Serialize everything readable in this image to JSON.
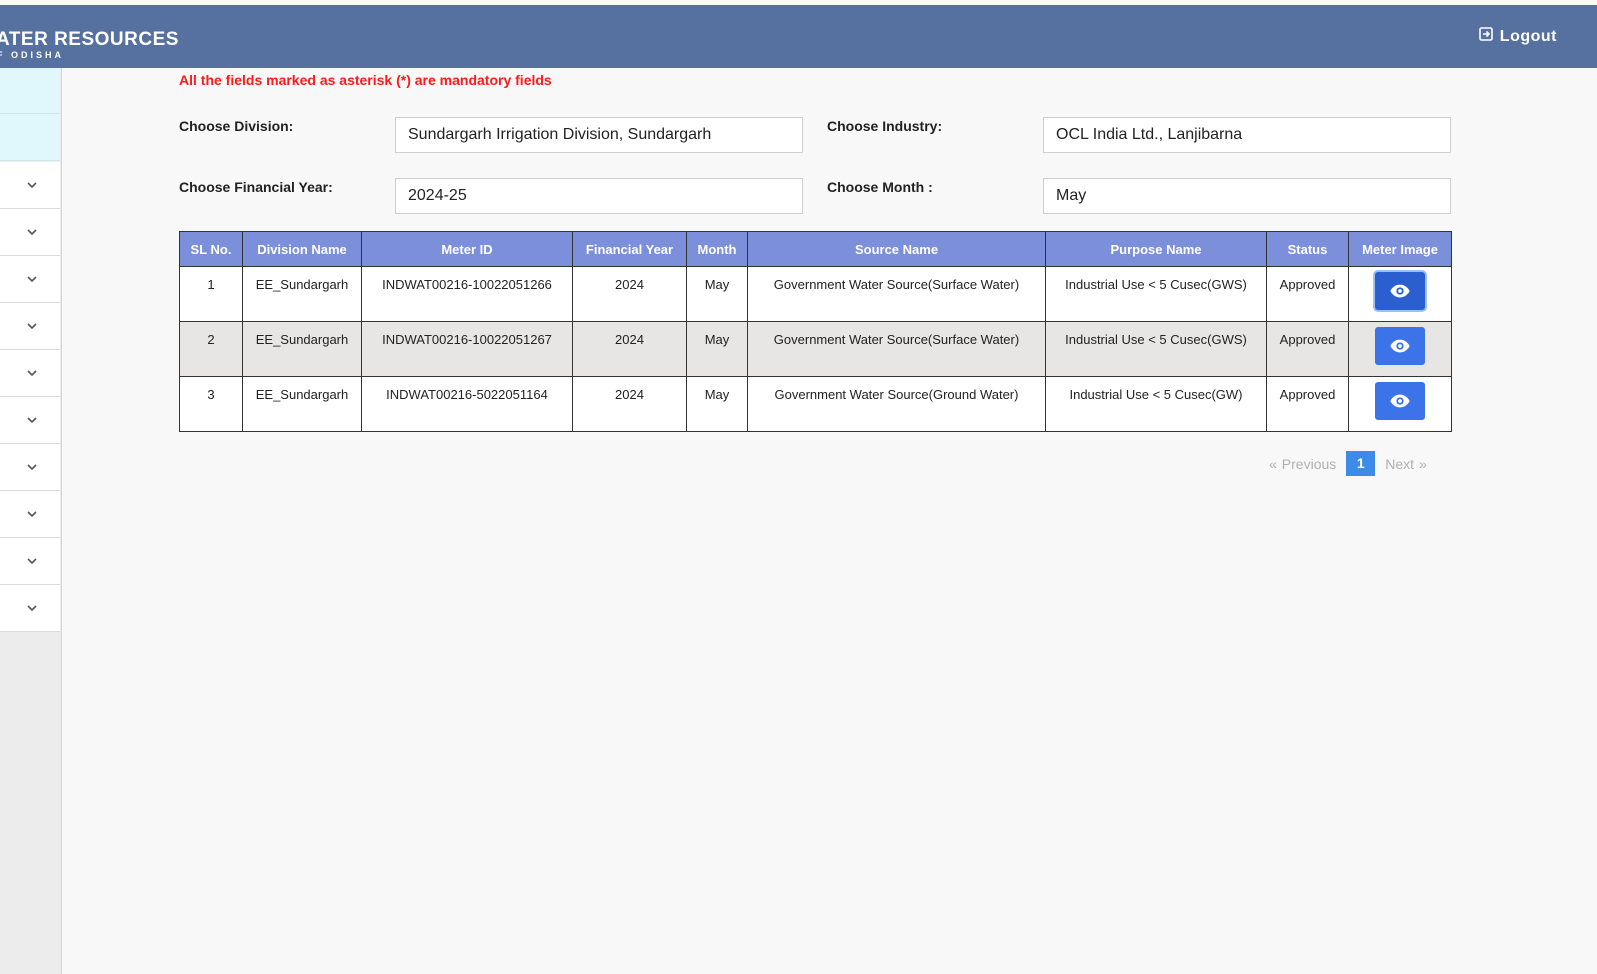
{
  "header": {
    "brand_title": "ATER RESOURCES",
    "brand_sub": "F ODISHA",
    "logout_label": "Logout"
  },
  "form": {
    "mandatory_note": "All the fields marked as asterisk (*) are mandatory fields",
    "division": {
      "label": "Choose Division:",
      "value": "Sundargarh Irrigation Division, Sundargarh"
    },
    "industry": {
      "label": "Choose Industry:",
      "value": "OCL India Ltd., Lanjibarna"
    },
    "financial_year": {
      "label": "Choose Financial Year:",
      "value": "2024-25"
    },
    "month": {
      "label": "Choose Month :",
      "value": "May"
    }
  },
  "table": {
    "headers": [
      "SL No.",
      "Division Name",
      "Meter ID",
      "Financial Year",
      "Month",
      "Source Name",
      "Purpose Name",
      "Status",
      "Meter Image"
    ],
    "rows": [
      {
        "sl": "1",
        "division": "EE_Sundargarh",
        "meter_id": "INDWAT00216-10022051266",
        "year": "2024",
        "month": "May",
        "source": "Government Water Source(Surface Water)",
        "purpose": "Industrial Use < 5 Cusec(GWS)",
        "status": "Approved"
      },
      {
        "sl": "2",
        "division": "EE_Sundargarh",
        "meter_id": "INDWAT00216-10022051267",
        "year": "2024",
        "month": "May",
        "source": "Government Water Source(Surface Water)",
        "purpose": "Industrial Use < 5 Cusec(GWS)",
        "status": "Approved"
      },
      {
        "sl": "3",
        "division": "EE_Sundargarh",
        "meter_id": "INDWAT00216-5022051164",
        "year": "2024",
        "month": "May",
        "source": "Government Water Source(Ground Water)",
        "purpose": "Industrial Use < 5 Cusec(GW)",
        "status": "Approved"
      }
    ]
  },
  "pagination": {
    "prev_arrow": "«",
    "previous": "Previous",
    "current": "1",
    "next": "Next",
    "next_arrow": "»"
  },
  "icons": {
    "logout": "logout-icon",
    "view": "eye-icon",
    "expand": "chevron-down-icon"
  },
  "colors": {
    "header_bg": "#5670a0",
    "table_header_bg": "#7b8fdb",
    "view_button": "#3d73e8",
    "mandatory_text": "#ff1a1a",
    "pagination_active": "#3d8be8"
  }
}
